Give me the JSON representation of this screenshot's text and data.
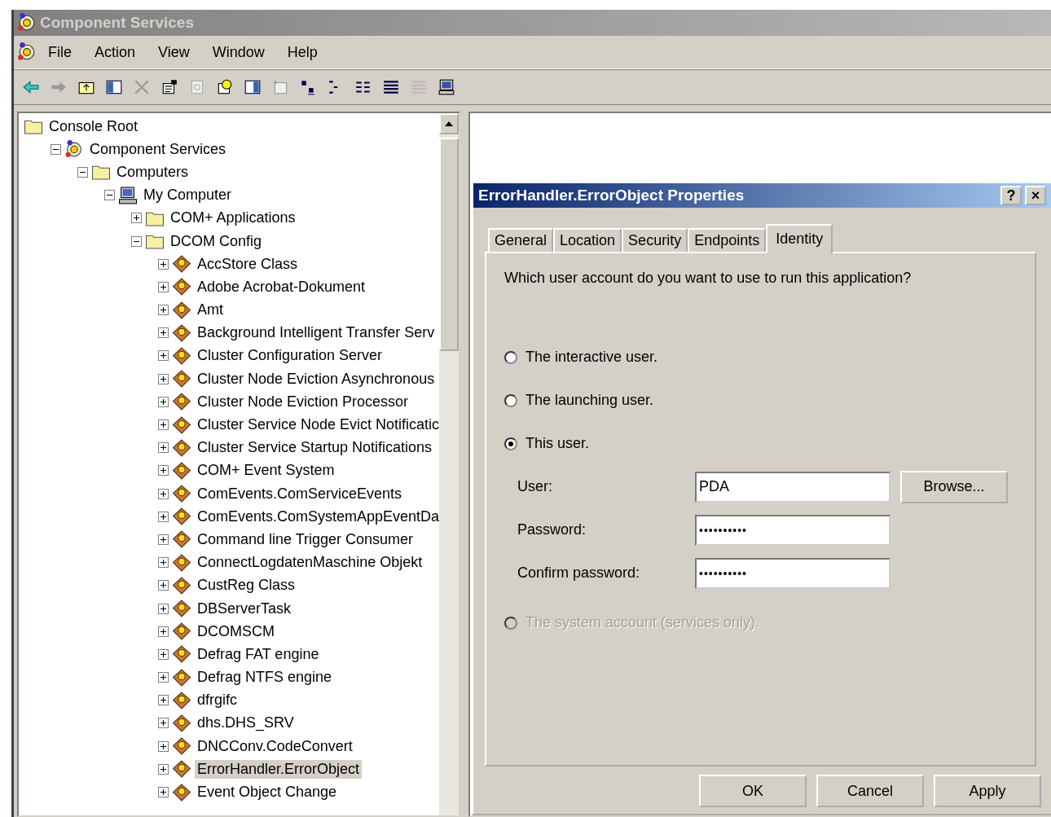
{
  "window": {
    "title": "Component Services"
  },
  "menu": [
    "File",
    "Action",
    "View",
    "Window",
    "Help"
  ],
  "tree": [
    {
      "label": "Console Root",
      "kind": "folder",
      "selected": false,
      "children": [
        {
          "label": "Component Services",
          "kind": "services",
          "expanded": true,
          "selected": false,
          "children": [
            {
              "label": "Computers",
              "kind": "folder",
              "expanded": true,
              "selected": false,
              "children": [
                {
                  "label": "My Computer",
                  "kind": "computer",
                  "expanded": true,
                  "selected": false,
                  "children": [
                    {
                      "label": "COM+ Applications",
                      "kind": "folder",
                      "expanded": false,
                      "selected": false
                    },
                    {
                      "label": "DCOM Config",
                      "kind": "folder",
                      "expanded": true,
                      "selected": false,
                      "children": [
                        {
                          "label": "AccStore Class",
                          "kind": "component",
                          "expanded": false,
                          "selected": false
                        },
                        {
                          "label": "Adobe Acrobat-Dokument",
                          "kind": "component",
                          "expanded": false,
                          "selected": false
                        },
                        {
                          "label": "Amt",
                          "kind": "component",
                          "expanded": false,
                          "selected": false
                        },
                        {
                          "label": "Background Intelligent Transfer Serv",
                          "kind": "component",
                          "expanded": false,
                          "selected": false
                        },
                        {
                          "label": "Cluster Configuration Server",
                          "kind": "component",
                          "expanded": false,
                          "selected": false
                        },
                        {
                          "label": "Cluster Node Eviction Asynchronous",
                          "kind": "component",
                          "expanded": false,
                          "selected": false
                        },
                        {
                          "label": "Cluster Node Eviction Processor",
                          "kind": "component",
                          "expanded": false,
                          "selected": false
                        },
                        {
                          "label": "Cluster Service Node Evict Notificatic",
                          "kind": "component",
                          "expanded": false,
                          "selected": false
                        },
                        {
                          "label": "Cluster Service Startup Notifications",
                          "kind": "component",
                          "expanded": false,
                          "selected": false
                        },
                        {
                          "label": "COM+ Event System",
                          "kind": "component",
                          "expanded": false,
                          "selected": false
                        },
                        {
                          "label": "ComEvents.ComServiceEvents",
                          "kind": "component",
                          "expanded": false,
                          "selected": false
                        },
                        {
                          "label": "ComEvents.ComSystemAppEventDa",
                          "kind": "component",
                          "expanded": false,
                          "selected": false
                        },
                        {
                          "label": "Command line Trigger Consumer",
                          "kind": "component",
                          "expanded": false,
                          "selected": false
                        },
                        {
                          "label": "ConnectLogdatenMaschine Objekt",
                          "kind": "component",
                          "expanded": false,
                          "selected": false
                        },
                        {
                          "label": "CustReg Class",
                          "kind": "component",
                          "expanded": false,
                          "selected": false
                        },
                        {
                          "label": "DBServerTask",
                          "kind": "component",
                          "expanded": false,
                          "selected": false
                        },
                        {
                          "label": "DCOMSCM",
                          "kind": "component",
                          "expanded": false,
                          "selected": false
                        },
                        {
                          "label": "Defrag FAT engine",
                          "kind": "component",
                          "expanded": false,
                          "selected": false
                        },
                        {
                          "label": "Defrag NTFS engine",
                          "kind": "component",
                          "expanded": false,
                          "selected": false
                        },
                        {
                          "label": "dfrgifc",
                          "kind": "component",
                          "expanded": false,
                          "selected": false
                        },
                        {
                          "label": "dhs.DHS_SRV",
                          "kind": "component",
                          "expanded": false,
                          "selected": false
                        },
                        {
                          "label": "DNCConv.CodeConvert",
                          "kind": "component",
                          "expanded": false,
                          "selected": false
                        },
                        {
                          "label": "ErrorHandler.ErrorObject",
                          "kind": "component",
                          "expanded": false,
                          "selected": true
                        },
                        {
                          "label": "Event Object Change",
                          "kind": "component",
                          "expanded": false,
                          "selected": false
                        }
                      ]
                    }
                  ]
                }
              ]
            }
          ]
        }
      ]
    }
  ],
  "dialog": {
    "title": "ErrorHandler.ErrorObject Properties",
    "help": "?",
    "close": "×",
    "tabs": [
      {
        "label": "General",
        "selected": false
      },
      {
        "label": "Location",
        "selected": false
      },
      {
        "label": "Security",
        "selected": false
      },
      {
        "label": "Endpoints",
        "selected": false
      },
      {
        "label": "Identity",
        "selected": true
      }
    ],
    "question": "Which user account do you want to use to run this application?",
    "options": [
      {
        "label": "The interactive user.",
        "selected": false,
        "disabled": false
      },
      {
        "label": "The launching user.",
        "selected": false,
        "disabled": false
      },
      {
        "label": "This user.",
        "selected": true,
        "disabled": false
      }
    ],
    "fields": [
      {
        "label": "User:",
        "value": "PDA",
        "button": "Browse..."
      },
      {
        "label": "Password:",
        "value": "••••••••••"
      },
      {
        "label": "Confirm password:",
        "value": "••••••••••"
      }
    ],
    "system_option": {
      "label": "The system account (services only).",
      "selected": false,
      "disabled": true
    },
    "buttons": [
      "OK",
      "Cancel",
      "Apply"
    ]
  }
}
